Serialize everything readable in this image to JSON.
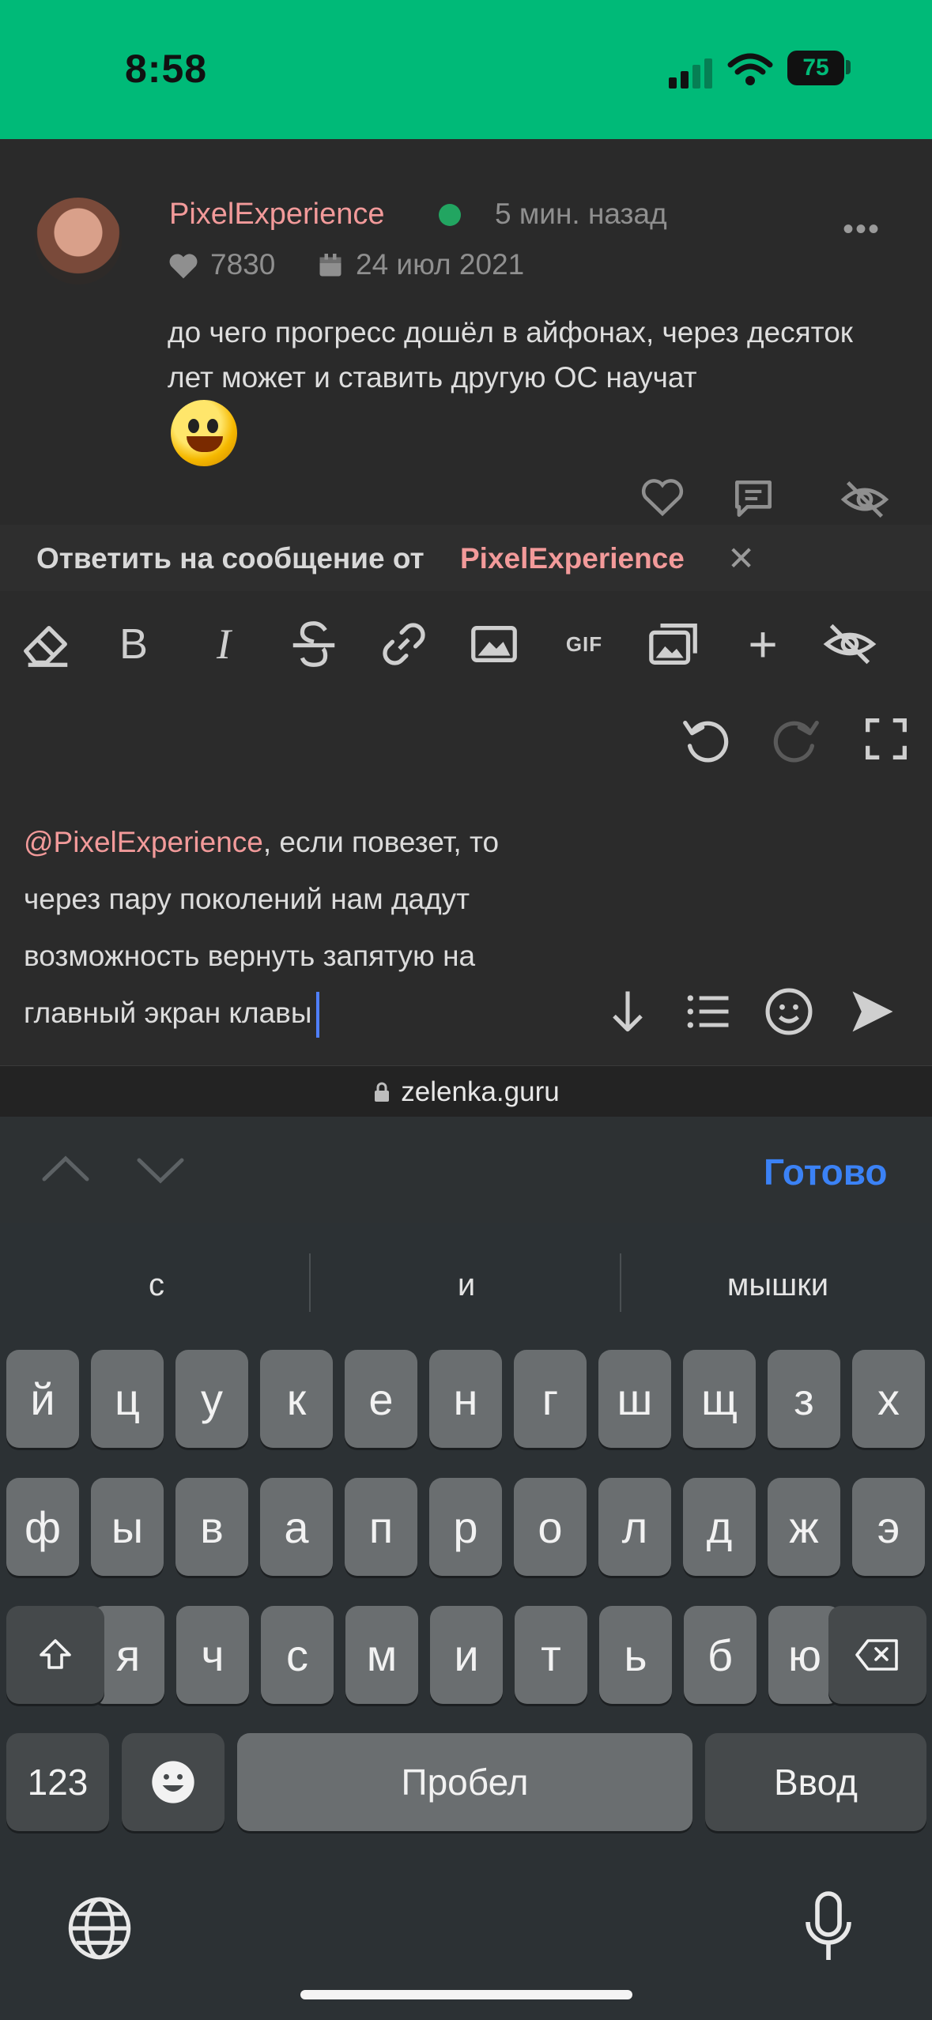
{
  "status_bar": {
    "time": "8:58",
    "battery": "75"
  },
  "post": {
    "author": "PixelExperience",
    "time_ago": "5 мин. назад",
    "likes": "7830",
    "join_date": "24 июл 2021",
    "text": "до чего прогресс дошёл в айфонах, через десяток лет может и ставить другую ОС научат"
  },
  "reply": {
    "prefix": "Ответить на сообщение от",
    "target": "PixelExperience"
  },
  "editor": {
    "toolbar": {
      "bold": "B",
      "italic": "I",
      "gif": "GIF"
    },
    "mention": "@PixelExperience",
    "message": ", если повезет, то через пару поколений нам дадут возможность вернуть запятую на главный экран клавы"
  },
  "browser": {
    "url": "zelenka.guru"
  },
  "accessory": {
    "done": "Готово"
  },
  "keyboard": {
    "suggestions": [
      "с",
      "и",
      "мышки"
    ],
    "row1": [
      "й",
      "ц",
      "у",
      "к",
      "е",
      "н",
      "г",
      "ш",
      "щ",
      "з",
      "х"
    ],
    "row2": [
      "ф",
      "ы",
      "в",
      "а",
      "п",
      "р",
      "о",
      "л",
      "д",
      "ж",
      "э"
    ],
    "row3": [
      "я",
      "ч",
      "с",
      "м",
      "и",
      "т",
      "ь",
      "б",
      "ю"
    ],
    "numbers": "123",
    "space": "Пробел",
    "return": "Ввод"
  },
  "colors": {
    "accent": "#00ba78",
    "mention": "#f29a9a",
    "link": "#3b82f6"
  }
}
